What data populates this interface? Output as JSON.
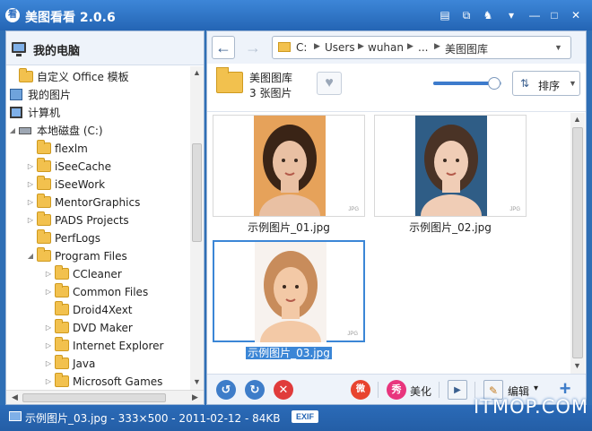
{
  "app": {
    "title": "美图看看 2.0.6",
    "logo_text": "看"
  },
  "titlebar": {
    "buttons": [
      {
        "name": "feedback",
        "glyph": "▤"
      },
      {
        "name": "skin",
        "glyph": "⧉"
      },
      {
        "name": "shirt",
        "glyph": "♞"
      },
      {
        "name": "menu",
        "glyph": "▾"
      },
      {
        "name": "minimize",
        "glyph": "—"
      },
      {
        "name": "maximize",
        "glyph": "□"
      },
      {
        "name": "close",
        "glyph": "✕"
      }
    ]
  },
  "sidebar": {
    "title": "我的电脑",
    "tree": [
      {
        "label": "自定义 Office 模板",
        "icon": "folder",
        "indent": 1,
        "arrow": ""
      },
      {
        "label": "我的图片",
        "icon": "pictures",
        "indent": 0,
        "arrow": ""
      },
      {
        "label": "计算机",
        "icon": "computer",
        "indent": 0,
        "arrow": ""
      },
      {
        "label": "本地磁盘 (C:)",
        "icon": "drive",
        "indent": 1,
        "arrow": "◢"
      },
      {
        "label": "flexlm",
        "icon": "folder",
        "indent": 2,
        "arrow": ""
      },
      {
        "label": "iSeeCache",
        "icon": "folder",
        "indent": 2,
        "arrow": "▷"
      },
      {
        "label": "iSeeWork",
        "icon": "folder",
        "indent": 2,
        "arrow": "▷"
      },
      {
        "label": "MentorGraphics",
        "icon": "folder",
        "indent": 2,
        "arrow": "▷"
      },
      {
        "label": "PADS Projects",
        "icon": "folder",
        "indent": 2,
        "arrow": "▷"
      },
      {
        "label": "PerfLogs",
        "icon": "folder",
        "indent": 2,
        "arrow": ""
      },
      {
        "label": "Program Files",
        "icon": "folder",
        "indent": 2,
        "arrow": "◢"
      },
      {
        "label": "CCleaner",
        "icon": "folder",
        "indent": 3,
        "arrow": "▷"
      },
      {
        "label": "Common Files",
        "icon": "folder",
        "indent": 3,
        "arrow": "▷"
      },
      {
        "label": "Droid4Xext",
        "icon": "folder",
        "indent": 3,
        "arrow": ""
      },
      {
        "label": "DVD Maker",
        "icon": "folder",
        "indent": 3,
        "arrow": "▷"
      },
      {
        "label": "Internet Explorer",
        "icon": "folder",
        "indent": 3,
        "arrow": "▷"
      },
      {
        "label": "Java",
        "icon": "folder",
        "indent": 3,
        "arrow": "▷"
      },
      {
        "label": "Microsoft Games",
        "icon": "folder",
        "indent": 3,
        "arrow": "▷"
      }
    ]
  },
  "nav": {
    "back_glyph": "←",
    "forward_glyph": "→",
    "breadcrumb": [
      "C:",
      "Users",
      "wuhan",
      "...",
      "美图图库"
    ],
    "dropdown_glyph": "▼"
  },
  "folder_info": {
    "name": "美图图库",
    "count": "3 张图片",
    "heart_glyph": "♥",
    "zoom_level": 0.9,
    "sort_label": "排序",
    "sort_icon": "⇅",
    "sort_caret": "▼"
  },
  "gallery": {
    "items": [
      {
        "filename": "示例图片_01.jpg",
        "tag": "JPG",
        "selected": false,
        "skin": "#e9c0a3",
        "bg": "#e6a25a",
        "hair": "#3a2416"
      },
      {
        "filename": "示例图片_02.jpg",
        "tag": "JPG",
        "selected": false,
        "skin": "#f0cdb6",
        "bg": "#2f5d86",
        "hair": "#4a3326"
      },
      {
        "filename": "示例图片_03.jpg",
        "tag": "JPG",
        "selected": true,
        "skin": "#f3c9a6",
        "bg": "#f7f2ee",
        "hair": "#c88c5b"
      }
    ]
  },
  "toolbar": {
    "rotate_left_glyph": "↺",
    "rotate_right_glyph": "↻",
    "delete_glyph": "✕",
    "weibo_glyph": "微",
    "xiu_glyph": "秀",
    "beautify_label": "美化",
    "slideshow_glyph": "▶",
    "edit_label": "编辑",
    "edit_caret": "▾",
    "add_glyph": "+"
  },
  "status": {
    "text": "示例图片_03.jpg - 333×500 - 2011-02-12 - 84KB",
    "exif_label": "EXIF"
  },
  "watermark": "ITMOP.COM",
  "colors": {
    "accent": "#2465b4",
    "selection": "#3b86d6",
    "folder": "#f2c14e"
  }
}
